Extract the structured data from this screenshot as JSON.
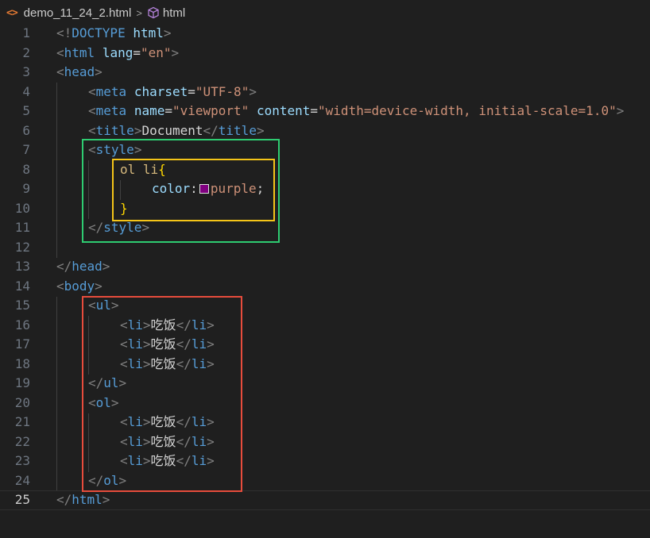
{
  "breadcrumb": {
    "file_icon": "<>",
    "file_name": "demo_11_24_2.html",
    "separator": ">",
    "symbol_name": "html"
  },
  "lines": [
    {
      "n": "1",
      "indent": 0,
      "tokens": [
        [
          "t-bracket",
          "<!"
        ],
        [
          "t-tag",
          "DOCTYPE"
        ],
        [
          "t-text",
          " "
        ],
        [
          "t-attr",
          "html"
        ],
        [
          "t-bracket",
          ">"
        ]
      ]
    },
    {
      "n": "2",
      "indent": 0,
      "tokens": [
        [
          "t-bracket",
          "<"
        ],
        [
          "t-tag",
          "html"
        ],
        [
          "t-text",
          " "
        ],
        [
          "t-attr",
          "lang"
        ],
        [
          "t-punc",
          "="
        ],
        [
          "t-str",
          "\"en\""
        ],
        [
          "t-bracket",
          ">"
        ]
      ]
    },
    {
      "n": "3",
      "indent": 0,
      "tokens": [
        [
          "t-bracket",
          "<"
        ],
        [
          "t-tag",
          "head"
        ],
        [
          "t-bracket",
          ">"
        ]
      ]
    },
    {
      "n": "4",
      "indent": 1,
      "tokens": [
        [
          "t-bracket",
          "<"
        ],
        [
          "t-tag",
          "meta"
        ],
        [
          "t-text",
          " "
        ],
        [
          "t-attr",
          "charset"
        ],
        [
          "t-punc",
          "="
        ],
        [
          "t-str",
          "\"UTF-8\""
        ],
        [
          "t-bracket",
          ">"
        ]
      ]
    },
    {
      "n": "5",
      "indent": 1,
      "tokens": [
        [
          "t-bracket",
          "<"
        ],
        [
          "t-tag",
          "meta"
        ],
        [
          "t-text",
          " "
        ],
        [
          "t-attr",
          "name"
        ],
        [
          "t-punc",
          "="
        ],
        [
          "t-str",
          "\"viewport\""
        ],
        [
          "t-text",
          " "
        ],
        [
          "t-attr",
          "content"
        ],
        [
          "t-punc",
          "="
        ],
        [
          "t-str",
          "\"width=device-width, initial-scale=1.0\""
        ],
        [
          "t-bracket",
          ">"
        ]
      ]
    },
    {
      "n": "6",
      "indent": 1,
      "tokens": [
        [
          "t-bracket",
          "<"
        ],
        [
          "t-tag",
          "title"
        ],
        [
          "t-bracket",
          ">"
        ],
        [
          "t-text",
          "Document"
        ],
        [
          "t-bracket",
          "</"
        ],
        [
          "t-tag",
          "title"
        ],
        [
          "t-bracket",
          ">"
        ]
      ]
    },
    {
      "n": "7",
      "indent": 1,
      "tokens": [
        [
          "t-bracket",
          "<"
        ],
        [
          "t-tag",
          "style"
        ],
        [
          "t-bracket",
          ">"
        ]
      ]
    },
    {
      "n": "8",
      "indent": 2,
      "tokens": [
        [
          "t-sel",
          "ol li"
        ],
        [
          "t-brace",
          "{"
        ]
      ]
    },
    {
      "n": "9",
      "indent": 3,
      "tokens": [
        [
          "t-prop",
          "color"
        ],
        [
          "t-punc",
          ":"
        ],
        [
          "swatch",
          "#800080"
        ],
        [
          "t-val",
          "purple"
        ],
        [
          "t-punc",
          ";"
        ]
      ]
    },
    {
      "n": "10",
      "indent": 2,
      "tokens": [
        [
          "t-brace",
          "}"
        ]
      ]
    },
    {
      "n": "11",
      "indent": 1,
      "tokens": [
        [
          "t-bracket",
          "</"
        ],
        [
          "t-tag",
          "style"
        ],
        [
          "t-bracket",
          ">"
        ]
      ]
    },
    {
      "n": "12",
      "indent": 0,
      "tokens": []
    },
    {
      "n": "13",
      "indent": 0,
      "tokens": [
        [
          "t-bracket",
          "</"
        ],
        [
          "t-tag",
          "head"
        ],
        [
          "t-bracket",
          ">"
        ]
      ]
    },
    {
      "n": "14",
      "indent": 0,
      "tokens": [
        [
          "t-bracket",
          "<"
        ],
        [
          "t-tag",
          "body"
        ],
        [
          "t-bracket",
          ">"
        ]
      ]
    },
    {
      "n": "15",
      "indent": 1,
      "tokens": [
        [
          "t-bracket",
          "<"
        ],
        [
          "t-tag",
          "ul"
        ],
        [
          "t-bracket",
          ">"
        ]
      ]
    },
    {
      "n": "16",
      "indent": 2,
      "tokens": [
        [
          "t-bracket",
          "<"
        ],
        [
          "t-tag",
          "li"
        ],
        [
          "t-bracket",
          ">"
        ],
        [
          "t-text",
          "吃饭"
        ],
        [
          "t-bracket",
          "</"
        ],
        [
          "t-tag",
          "li"
        ],
        [
          "t-bracket",
          ">"
        ]
      ]
    },
    {
      "n": "17",
      "indent": 2,
      "tokens": [
        [
          "t-bracket",
          "<"
        ],
        [
          "t-tag",
          "li"
        ],
        [
          "t-bracket",
          ">"
        ],
        [
          "t-text",
          "吃饭"
        ],
        [
          "t-bracket",
          "</"
        ],
        [
          "t-tag",
          "li"
        ],
        [
          "t-bracket",
          ">"
        ]
      ]
    },
    {
      "n": "18",
      "indent": 2,
      "tokens": [
        [
          "t-bracket",
          "<"
        ],
        [
          "t-tag",
          "li"
        ],
        [
          "t-bracket",
          ">"
        ],
        [
          "t-text",
          "吃饭"
        ],
        [
          "t-bracket",
          "</"
        ],
        [
          "t-tag",
          "li"
        ],
        [
          "t-bracket",
          ">"
        ]
      ]
    },
    {
      "n": "19",
      "indent": 1,
      "tokens": [
        [
          "t-bracket",
          "</"
        ],
        [
          "t-tag",
          "ul"
        ],
        [
          "t-bracket",
          ">"
        ]
      ]
    },
    {
      "n": "20",
      "indent": 1,
      "tokens": [
        [
          "t-bracket",
          "<"
        ],
        [
          "t-tag",
          "ol"
        ],
        [
          "t-bracket",
          ">"
        ]
      ]
    },
    {
      "n": "21",
      "indent": 2,
      "tokens": [
        [
          "t-bracket",
          "<"
        ],
        [
          "t-tag",
          "li"
        ],
        [
          "t-bracket",
          ">"
        ],
        [
          "t-text",
          "吃饭"
        ],
        [
          "t-bracket",
          "</"
        ],
        [
          "t-tag",
          "li"
        ],
        [
          "t-bracket",
          ">"
        ]
      ]
    },
    {
      "n": "22",
      "indent": 2,
      "tokens": [
        [
          "t-bracket",
          "<"
        ],
        [
          "t-tag",
          "li"
        ],
        [
          "t-bracket",
          ">"
        ],
        [
          "t-text",
          "吃饭"
        ],
        [
          "t-bracket",
          "</"
        ],
        [
          "t-tag",
          "li"
        ],
        [
          "t-bracket",
          ">"
        ]
      ]
    },
    {
      "n": "23",
      "indent": 2,
      "tokens": [
        [
          "t-bracket",
          "<"
        ],
        [
          "t-tag",
          "li"
        ],
        [
          "t-bracket",
          ">"
        ],
        [
          "t-text",
          "吃饭"
        ],
        [
          "t-bracket",
          "</"
        ],
        [
          "t-tag",
          "li"
        ],
        [
          "t-bracket",
          ">"
        ]
      ]
    },
    {
      "n": "24",
      "indent": 1,
      "tokens": [
        [
          "t-bracket",
          "</"
        ],
        [
          "t-tag",
          "ol"
        ],
        [
          "t-bracket",
          ">"
        ]
      ]
    },
    {
      "n": "25",
      "indent": 0,
      "current": true,
      "tokens": [
        [
          "t-bracket",
          "</"
        ],
        [
          "t-tag",
          "html"
        ],
        [
          "t-bracket",
          ">"
        ]
      ]
    }
  ],
  "annotations": [
    {
      "name": "green-highlight-box",
      "color": "#2ecc71"
    },
    {
      "name": "yellow-highlight-box",
      "color": "#f5c518"
    },
    {
      "name": "red-highlight-box",
      "color": "#e74c3c"
    }
  ],
  "colors": {
    "background": "#1f1f1f",
    "swatch_purple": "#800080"
  }
}
